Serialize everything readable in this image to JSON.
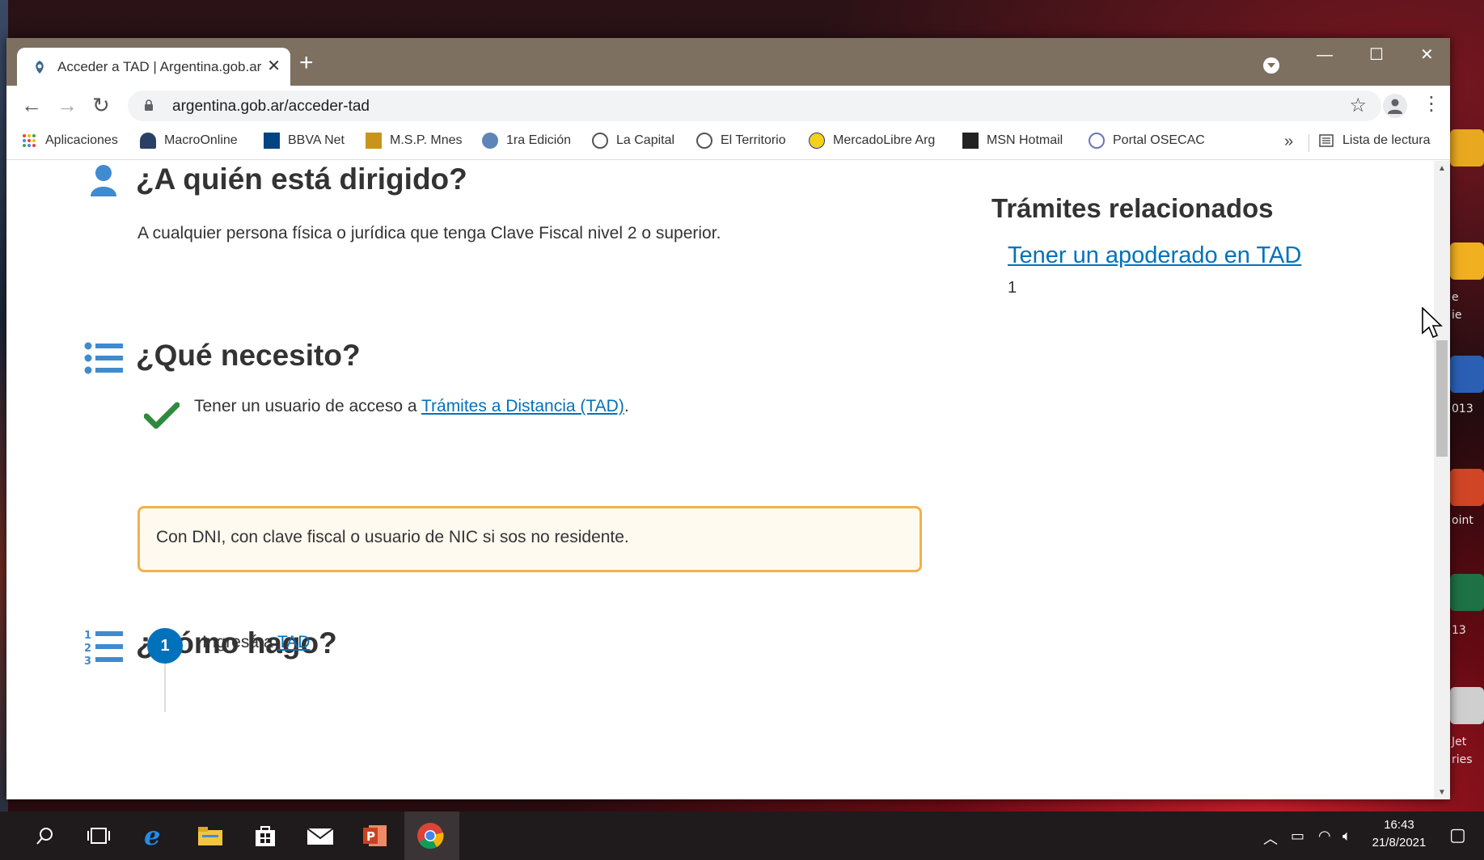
{
  "browser": {
    "tab_title": "Acceder a TAD | Argentina.gob.ar",
    "tab_close": "✕",
    "new_tab": "+",
    "url": "argentina.gob.ar/acceder-tad",
    "window_controls": {
      "minimize": "—",
      "maximize": "☐",
      "close": "✕"
    },
    "more_bookmarks": "»",
    "bookmarks": [
      {
        "label": "Aplicaciones",
        "icon": "apps-grid-icon"
      },
      {
        "label": "MacroOnline",
        "icon": "macro-icon"
      },
      {
        "label": "BBVA Net",
        "icon": "bbva-icon"
      },
      {
        "label": "M.S.P. Mnes",
        "icon": "msp-icon"
      },
      {
        "label": "1ra Edición",
        "icon": "globe-icon"
      },
      {
        "label": "La Capital",
        "icon": "globe-icon"
      },
      {
        "label": "El Territorio",
        "icon": "globe-icon"
      },
      {
        "label": "MercadoLibre Arg",
        "icon": "mercadolibre-icon"
      },
      {
        "label": "MSN Hotmail",
        "icon": "msn-icon"
      },
      {
        "label": "Portal OSECAC",
        "icon": "osecac-icon"
      }
    ],
    "reading_list": "Lista de lectura"
  },
  "page": {
    "section1": {
      "title": "¿A quién está dirigido?",
      "text": "A cualquier persona física o jurídica que tenga Clave Fiscal nivel 2 o superior."
    },
    "section2": {
      "title": "¿Qué necesito?",
      "requirement_prefix": "Tener un usuario de acceso a ",
      "requirement_link": "Trámites a Distancia (TAD)",
      "requirement_suffix": ".",
      "alert": "Con DNI, con clave fiscal o usuario de NIC si sos no residente."
    },
    "section3": {
      "title": "¿Cómo hago?",
      "step_number": "1",
      "step_prefix": "Ingresá a ",
      "step_link": "TAD"
    },
    "sidebar": {
      "title": "Trámites relacionados",
      "link": "Tener un apoderado en TAD",
      "count": "1"
    }
  },
  "taskbar": {
    "time": "16:43",
    "date": "21/8/2021"
  },
  "desktop_labels": [
    "e",
    "ie",
    "013",
    "oint",
    "13",
    "Jet",
    "ries"
  ],
  "colors": {
    "link": "#0072bb",
    "alert_border": "#f0b24b",
    "check": "#2e8b3e",
    "titlebar": "#7d7060"
  }
}
